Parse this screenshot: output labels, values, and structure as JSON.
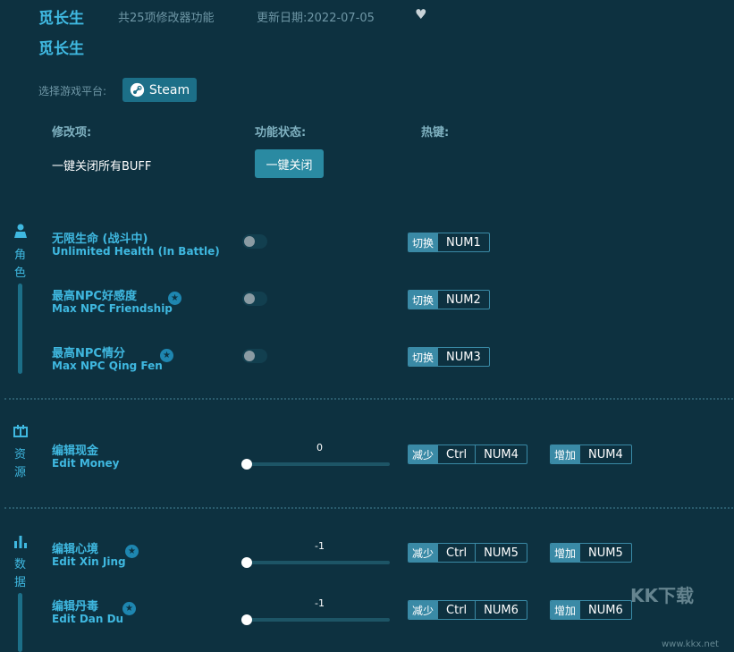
{
  "header": {
    "title": "觅长生",
    "feature_count": "共25项修改器功能",
    "update_date": "更新日期:2022-07-05",
    "subtitle": "觅长生"
  },
  "platform": {
    "label": "选择游戏平台:",
    "steam_label": "Steam"
  },
  "columns": {
    "mod": "修改项:",
    "status": "功能状态:",
    "hotkey": "热键:"
  },
  "buff": {
    "label": "一键关闭所有BUFF",
    "button": "一键关闭"
  },
  "categories": {
    "character": {
      "c1": "角",
      "c2": "色"
    },
    "resource": {
      "c1": "资",
      "c2": "源"
    },
    "data": {
      "c1": "数",
      "c2": "据"
    }
  },
  "items": [
    {
      "cn": "无限生命 (战斗中)",
      "en": "Unlimited Health (In Battle)",
      "act": "切换",
      "key": "NUM1"
    },
    {
      "cn": "最高NPC好感度",
      "en": "Max NPC Friendship",
      "act": "切换",
      "key": "NUM2"
    },
    {
      "cn": "最高NPC情分",
      "en": "Max NPC Qing Fen",
      "act": "切换",
      "key": "NUM3"
    }
  ],
  "sliders": [
    {
      "cn": "编辑现金",
      "en": "Edit Money",
      "value": "0",
      "dec": "减少",
      "inc": "增加",
      "mod": "Ctrl",
      "key": "NUM4"
    },
    {
      "cn": "编辑心境",
      "en": "Edit Xin Jing",
      "value": "-1",
      "dec": "减少",
      "inc": "增加",
      "mod": "Ctrl",
      "key": "NUM5"
    },
    {
      "cn": "编辑丹毒",
      "en": "Edit Dan Du",
      "value": "-1",
      "dec": "减少",
      "inc": "增加",
      "mod": "Ctrl",
      "key": "NUM6"
    }
  ],
  "watermark": {
    "logo": "KK下载",
    "url": "www.kkx.net"
  }
}
